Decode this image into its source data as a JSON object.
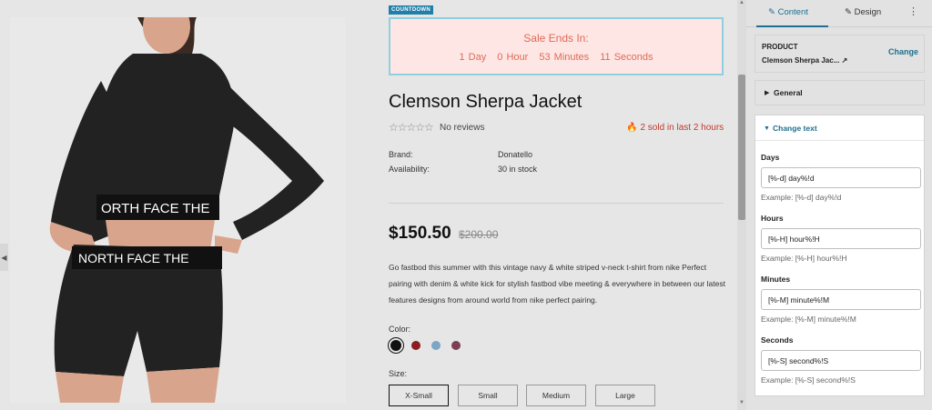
{
  "countdown": {
    "tag": "COUNTDOWN",
    "title": "Sale Ends In:",
    "days": "1 Day",
    "hours": "0 Hour",
    "minutes": "53 Minutes",
    "seconds": "11 Seconds"
  },
  "product": {
    "title": "Clemson Sherpa Jacket",
    "stars": "☆☆☆☆☆",
    "reviews": "No reviews",
    "sold": "2 sold in last 2 hours",
    "brand_label": "Brand:",
    "brand_value": "Donatello",
    "availability_label": "Availability:",
    "availability_value": "30 in stock",
    "price": "$150.50",
    "compare_price": "$200.00",
    "description": "Go fastbod this summer with this vintage navy & white striped v-neck t-shirt from nike Perfect pairing with denim & white kick for stylish fastbod vibe meeting & everywhere in between our latest features designs from around world from nike perfect pairing.",
    "color_label": "Color:",
    "colors": [
      "#111111",
      "#8c1d22",
      "#7ba6c4",
      "#7d3f55"
    ],
    "size_label": "Size:",
    "sizes": [
      "X-Small",
      "Small",
      "Medium",
      "Large"
    ],
    "selected_size": "X-Small",
    "image_text_top": "ORTH FACE THE",
    "image_text_bottom": "NORTH FACE THE"
  },
  "panel": {
    "tabs": {
      "content": "Content",
      "design": "Design"
    },
    "more": "⋮",
    "product_heading": "PRODUCT",
    "product_name": "Clemson Sherpa Jac...",
    "change_button": "Change",
    "general_label": "General",
    "change_text_label": "Change text",
    "fields": [
      {
        "label": "Days",
        "value": "[%-d] day%!d",
        "example": "Example: [%-d] day%!d"
      },
      {
        "label": "Hours",
        "value": "[%-H] hour%!H",
        "example": "Example: [%-H] hour%!H"
      },
      {
        "label": "Minutes",
        "value": "[%-M] minute%!M",
        "example": "Example: [%-M] minute%!M"
      },
      {
        "label": "Seconds",
        "value": "[%-S] second%!S",
        "example": "Example: [%-S] second%!S"
      }
    ]
  },
  "colors": {
    "accent": "#1e6f8f",
    "countdown_text": "#e26a58",
    "countdown_bg": "#fde6e3",
    "sold": "#c0392b"
  }
}
